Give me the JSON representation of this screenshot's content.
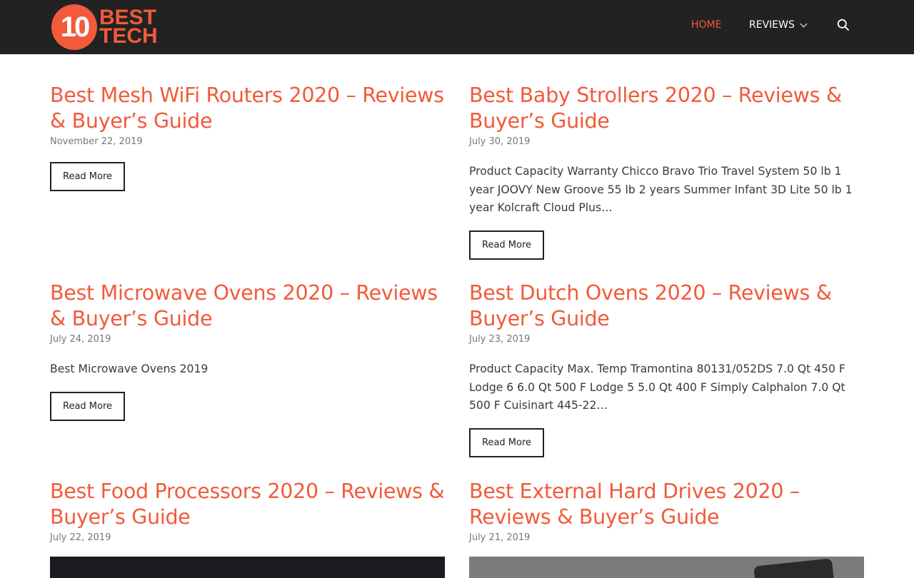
{
  "brand": {
    "logo_number": "10",
    "logo_word_1": "BEST",
    "logo_word_2": "TECH",
    "accent_color": "#f15a3a"
  },
  "nav": {
    "home": "HOME",
    "reviews": "REVIEWS"
  },
  "posts": [
    {
      "title": "Best Mesh WiFi Routers 2020 – Reviews & Buyer’s Guide",
      "date": "November 22, 2019",
      "excerpt": "",
      "read_more": "Read More"
    },
    {
      "title": "Best Baby Strollers 2020 – Reviews & Buyer’s Guide",
      "date": "July 30, 2019",
      "excerpt": "Product Capacity Warranty Chicco Bravo Trio Travel System 50 lb 1 year JOOVY New Groove 55 lb 2 years Summer Infant 3D Lite 50 lb 1 year Kolcraft Cloud Plus…",
      "read_more": "Read More"
    },
    {
      "title": "Best Microwave Ovens 2020 – Reviews & Buyer’s Guide",
      "date": "July 24, 2019",
      "excerpt": "Best Microwave Ovens 2019",
      "read_more": "Read More"
    },
    {
      "title": "Best Dutch Ovens 2020 – Reviews & Buyer’s Guide",
      "date": "July 23, 2019",
      "excerpt": "Product Capacity Max. Temp Tramontina 80131/052DS 7.0 Qt 450 F Lodge 6 6.0 Qt 500 F Lodge 5 5.0 Qt 400 F Simply Calphalon 7.0 Qt 500 F Cuisinart 445-22…",
      "read_more": "Read More"
    },
    {
      "title": "Best Food Processors 2020 – Reviews & Buyer’s Guide",
      "date": "July 22, 2019",
      "excerpt": "",
      "read_more": ""
    },
    {
      "title": "Best External Hard Drives 2020 – Reviews & Buyer’s Guide",
      "date": "July 21, 2019",
      "excerpt": "",
      "read_more": ""
    }
  ]
}
